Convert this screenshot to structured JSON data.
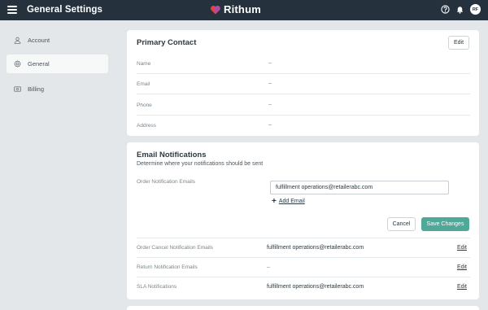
{
  "header": {
    "title": "General Settings",
    "logo_text": "Rithum",
    "avatar_initials": "RF",
    "icons": [
      "menu-icon",
      "help-icon",
      "bell-icon"
    ],
    "colors": {
      "bar": "#25323e",
      "accent": "#4fa898"
    }
  },
  "sidebar": {
    "items": [
      {
        "label": "Account",
        "icon": "user-icon",
        "active": false
      },
      {
        "label": "General",
        "icon": "gear-icon",
        "active": true
      },
      {
        "label": "Billing",
        "icon": "billing-icon",
        "active": false
      }
    ]
  },
  "primary_contact": {
    "title": "Primary Contact",
    "edit_label": "Edit",
    "fields": [
      {
        "label": "Name",
        "value": "–"
      },
      {
        "label": "Email",
        "value": "–"
      },
      {
        "label": "Phone",
        "value": "–"
      },
      {
        "label": "Address",
        "value": "–"
      }
    ]
  },
  "email_notifications": {
    "title": "Email Notifications",
    "subtitle": "Determine where your notifications should be sent",
    "order_label": "Order Notification Emails",
    "order_value": "fulfillment operations@retailerabc.com",
    "add_email_label": "Add Email",
    "cancel_label": "Cancel",
    "save_label": "Save Changes",
    "rows": [
      {
        "label": "Order Cancel Notification Emails",
        "value": "fulfillment operations@retailerabc.com",
        "edit": "Edit"
      },
      {
        "label": "Return Notification Emails",
        "value": "–",
        "edit": "Edit"
      },
      {
        "label": "SLA Notifications",
        "value": "fulfillment operations@retailerabc.com",
        "edit": "Edit"
      }
    ]
  }
}
